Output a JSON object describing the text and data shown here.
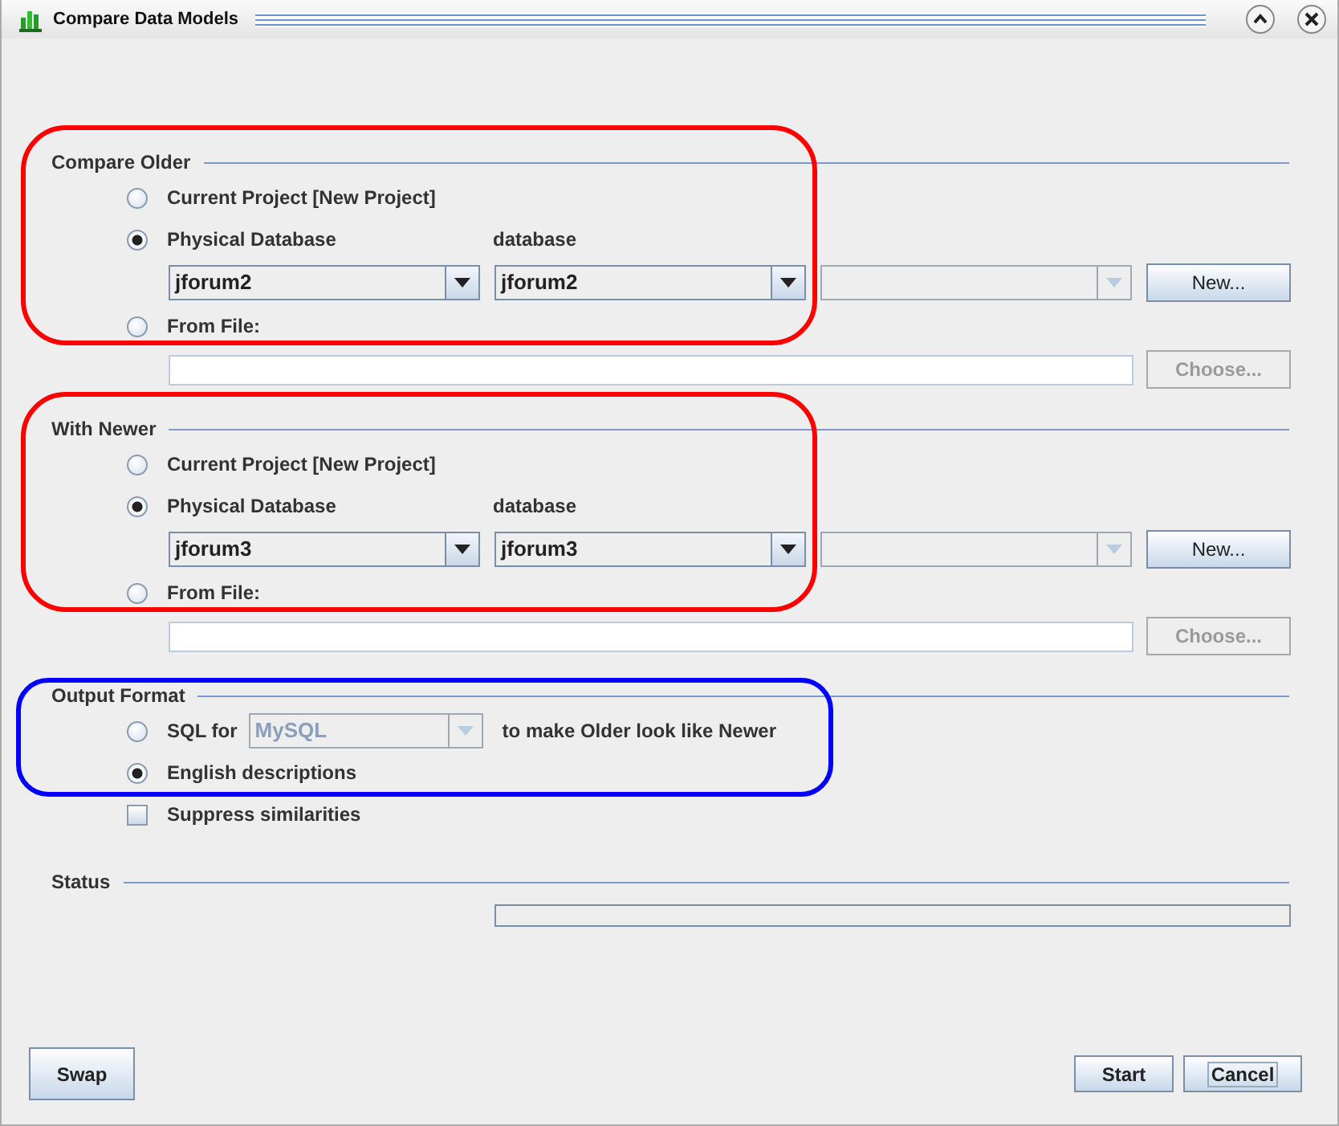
{
  "window": {
    "title": "Compare Data Models"
  },
  "source_sections": [
    {
      "title": "Compare Older",
      "color": "#ff0000",
      "options": [
        {
          "label": "Current Project [New Project]",
          "selected": false
        },
        {
          "label": "Physical Database",
          "selected": true
        },
        {
          "label": "From File:",
          "selected": false
        }
      ],
      "database_label": "database",
      "connection": "jforum2",
      "database": "jforum2",
      "new_button": "New...",
      "choose_button": "Choose...",
      "choose_disabled": true
    },
    {
      "title": "With Newer",
      "color": "#ff0000",
      "options": [
        {
          "label": "Current Project [New Project]",
          "selected": false
        },
        {
          "label": "Physical Database",
          "selected": true
        },
        {
          "label": "From File:",
          "selected": false
        }
      ],
      "database_label": "database",
      "connection": "jforum3",
      "database": "jforum3",
      "new_button": "New...",
      "choose_button": "Choose...",
      "choose_disabled": true
    }
  ],
  "output": {
    "title": "Output Format",
    "color": "#0000ff",
    "options": [
      {
        "kind": "sql",
        "label": "SQL for",
        "dialect": "MySQL",
        "dialect_disabled": true,
        "suffix": "to make Older look like Newer",
        "selected": false
      },
      {
        "kind": "plain",
        "label": "English descriptions",
        "selected": true
      }
    ],
    "suppress": {
      "label": "Suppress similarities",
      "checked": false
    }
  },
  "status": {
    "title": "Status",
    "level": 0
  },
  "buttons": {
    "left": [
      {
        "label": "Swap",
        "focused": false
      }
    ],
    "right": [
      {
        "label": "Start",
        "focused": false
      },
      {
        "label": "Cancel",
        "focused": true
      }
    ]
  }
}
